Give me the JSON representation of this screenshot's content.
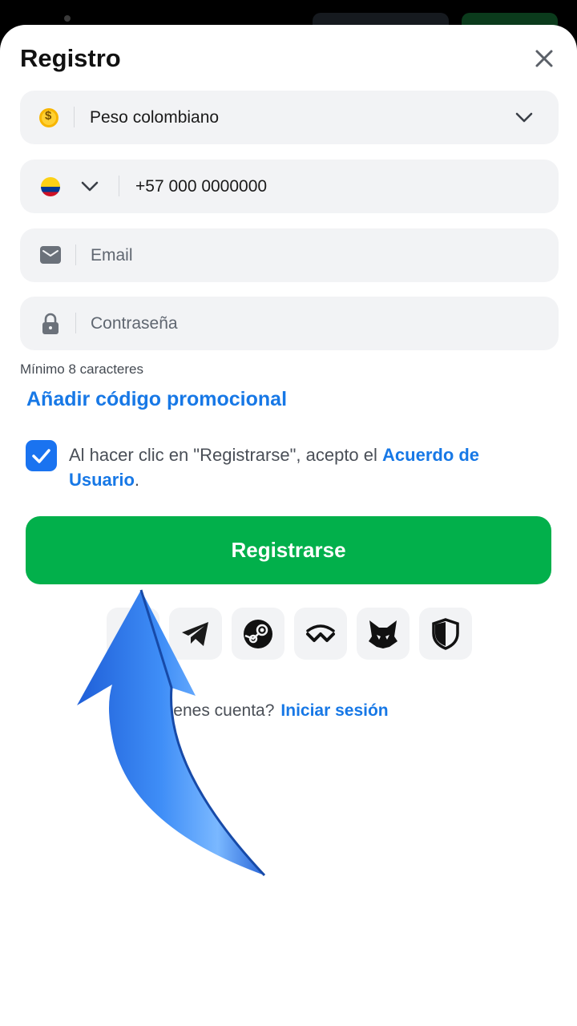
{
  "modal": {
    "title": "Registro"
  },
  "currency": {
    "icon": "coin-dollar-icon",
    "symbol": "$",
    "value": "Peso colombiano"
  },
  "phone": {
    "flag": "colombia-flag-icon",
    "value": "+57 000 0000000"
  },
  "email": {
    "placeholder": "Email"
  },
  "password": {
    "placeholder": "Contraseña",
    "hint": "Mínimo 8 caracteres"
  },
  "promo": {
    "label": "Añadir código promocional"
  },
  "terms": {
    "checked": true,
    "text": "Al hacer clic en \"Registrarse\", acepto el ",
    "link": "Acuerdo de Usuario",
    "end": "."
  },
  "submit": {
    "label": "Registrarse"
  },
  "social": [
    "telegram-icon",
    "steam-icon",
    "walletconnect-icon",
    "metamask-icon",
    "shield-icon"
  ],
  "login": {
    "question": "¿Ya tienes cuenta?",
    "link": "Iniciar sesión"
  },
  "colors": {
    "primary_green": "#02b04b",
    "link_blue": "#1778e6",
    "field_bg": "#f2f3f5"
  }
}
